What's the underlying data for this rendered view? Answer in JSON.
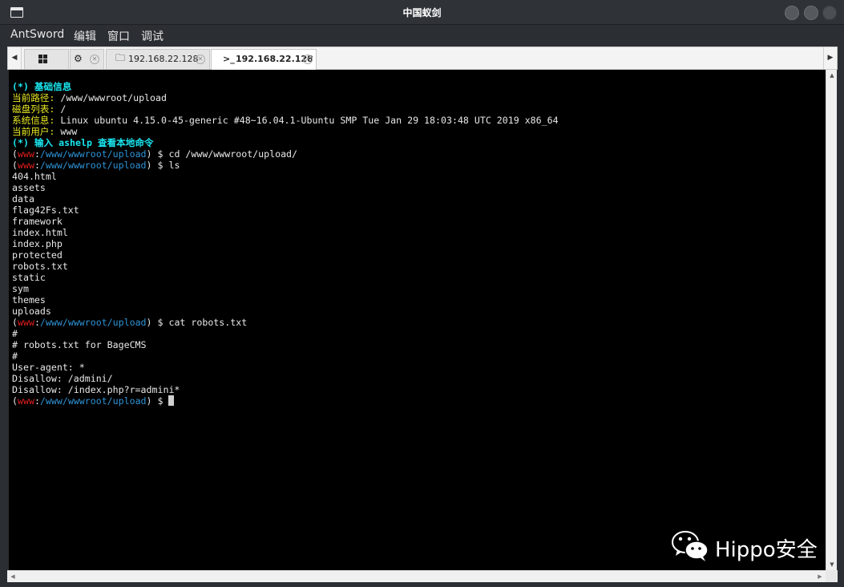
{
  "window": {
    "title": "中国蚁剑"
  },
  "menu": {
    "items": [
      "AntSword",
      "编辑",
      "窗口",
      "调试"
    ]
  },
  "tabs": [
    {
      "label": "",
      "icon": "grid-icon"
    },
    {
      "label": "",
      "icon": "gear-icon"
    },
    {
      "label": "192.168.22.128",
      "icon": "folder-icon"
    },
    {
      "label": "192.168.22.128",
      "icon": "terminal-icon",
      "active": true
    }
  ],
  "terminal": {
    "info_header": "(*) 基础信息",
    "path_label": "当前路径",
    "path_value": "/www/wwwroot/upload",
    "disk_label": "磁盘列表",
    "disk_value": "/",
    "system_label": "系统信息",
    "system_value": "Linux ubuntu 4.15.0-45-generic #48~16.04.1-Ubuntu SMP Tue Jan 29 18:03:48 UTC 2019 x86_64",
    "user_label": "当前用户",
    "user_value": "www",
    "help_line": "(*) 输入 ashelp 查看本地命令",
    "prompt_user": "www",
    "prompt_path": "/www/wwwroot/upload",
    "cmd1": "cd /www/wwwroot/upload/",
    "cmd2": "ls",
    "ls_output": [
      "404.html",
      "assets",
      "data",
      "flag42Fs.txt",
      "framework",
      "index.html",
      "index.php",
      "protected",
      "robots.txt",
      "static",
      "sym",
      "themes",
      "uploads"
    ],
    "cmd3": "cat robots.txt",
    "cat_output": [
      "#",
      "# robots.txt for BageCMS",
      "#",
      "User-agent: *",
      "Disallow: /admini/",
      "Disallow: /index.php?r=admini*"
    ]
  },
  "watermark": {
    "text": "Hippo安全"
  },
  "colors": {
    "cyan": "#19e6ef",
    "yellow": "#e8e823",
    "red": "#e41d1d",
    "blue": "#2f93d6",
    "background": "#000000"
  }
}
